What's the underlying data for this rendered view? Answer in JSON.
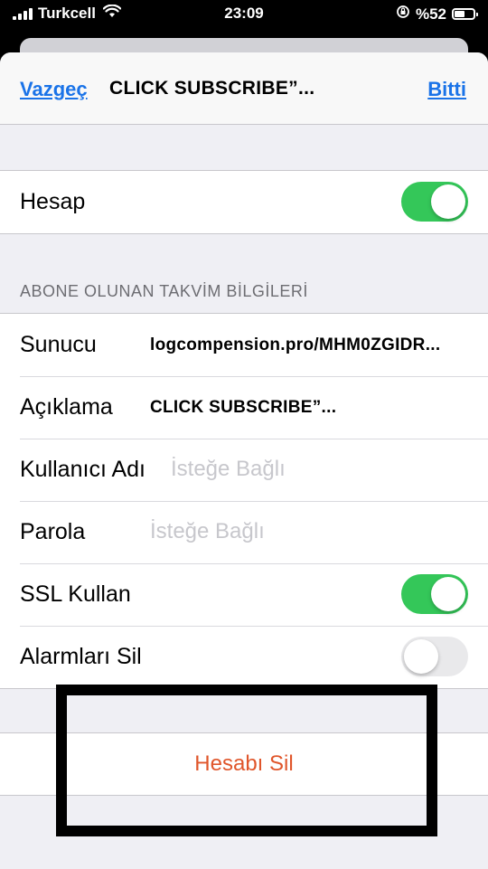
{
  "status_bar": {
    "carrier": "Turkcell",
    "time": "23:09",
    "battery": "%52",
    "battery_level": 0.52
  },
  "navbar": {
    "cancel_label": "Vazgeç",
    "title": "CLICK SUBSCRIBE”...",
    "done_label": "Bitti"
  },
  "account": {
    "label": "Hesap",
    "toggle_on": true
  },
  "subscribed_section": {
    "header": "ABONE OLUNAN TAKVİM BİLGİLERİ",
    "server_label": "Sunucu",
    "server_value": "logcompension.pro/MHM0ZGIDR...",
    "description_label": "Açıklama",
    "description_value": "CLICK SUBSCRIBE”...",
    "username_label": "Kullanıcı Adı",
    "username_placeholder": "İsteğe Bağlı",
    "password_label": "Parola",
    "password_placeholder": "İsteğe Bağlı",
    "ssl_label": "SSL Kullan",
    "ssl_on": true,
    "remove_alarms_label": "Alarmları Sil",
    "remove_alarms_on": false
  },
  "delete_account_label": "Hesabı Sil",
  "colors": {
    "link_blue": "#1a73e8",
    "toggle_green": "#34c759",
    "destructive_red": "#e0562b",
    "grouped_background": "#efeff4"
  }
}
